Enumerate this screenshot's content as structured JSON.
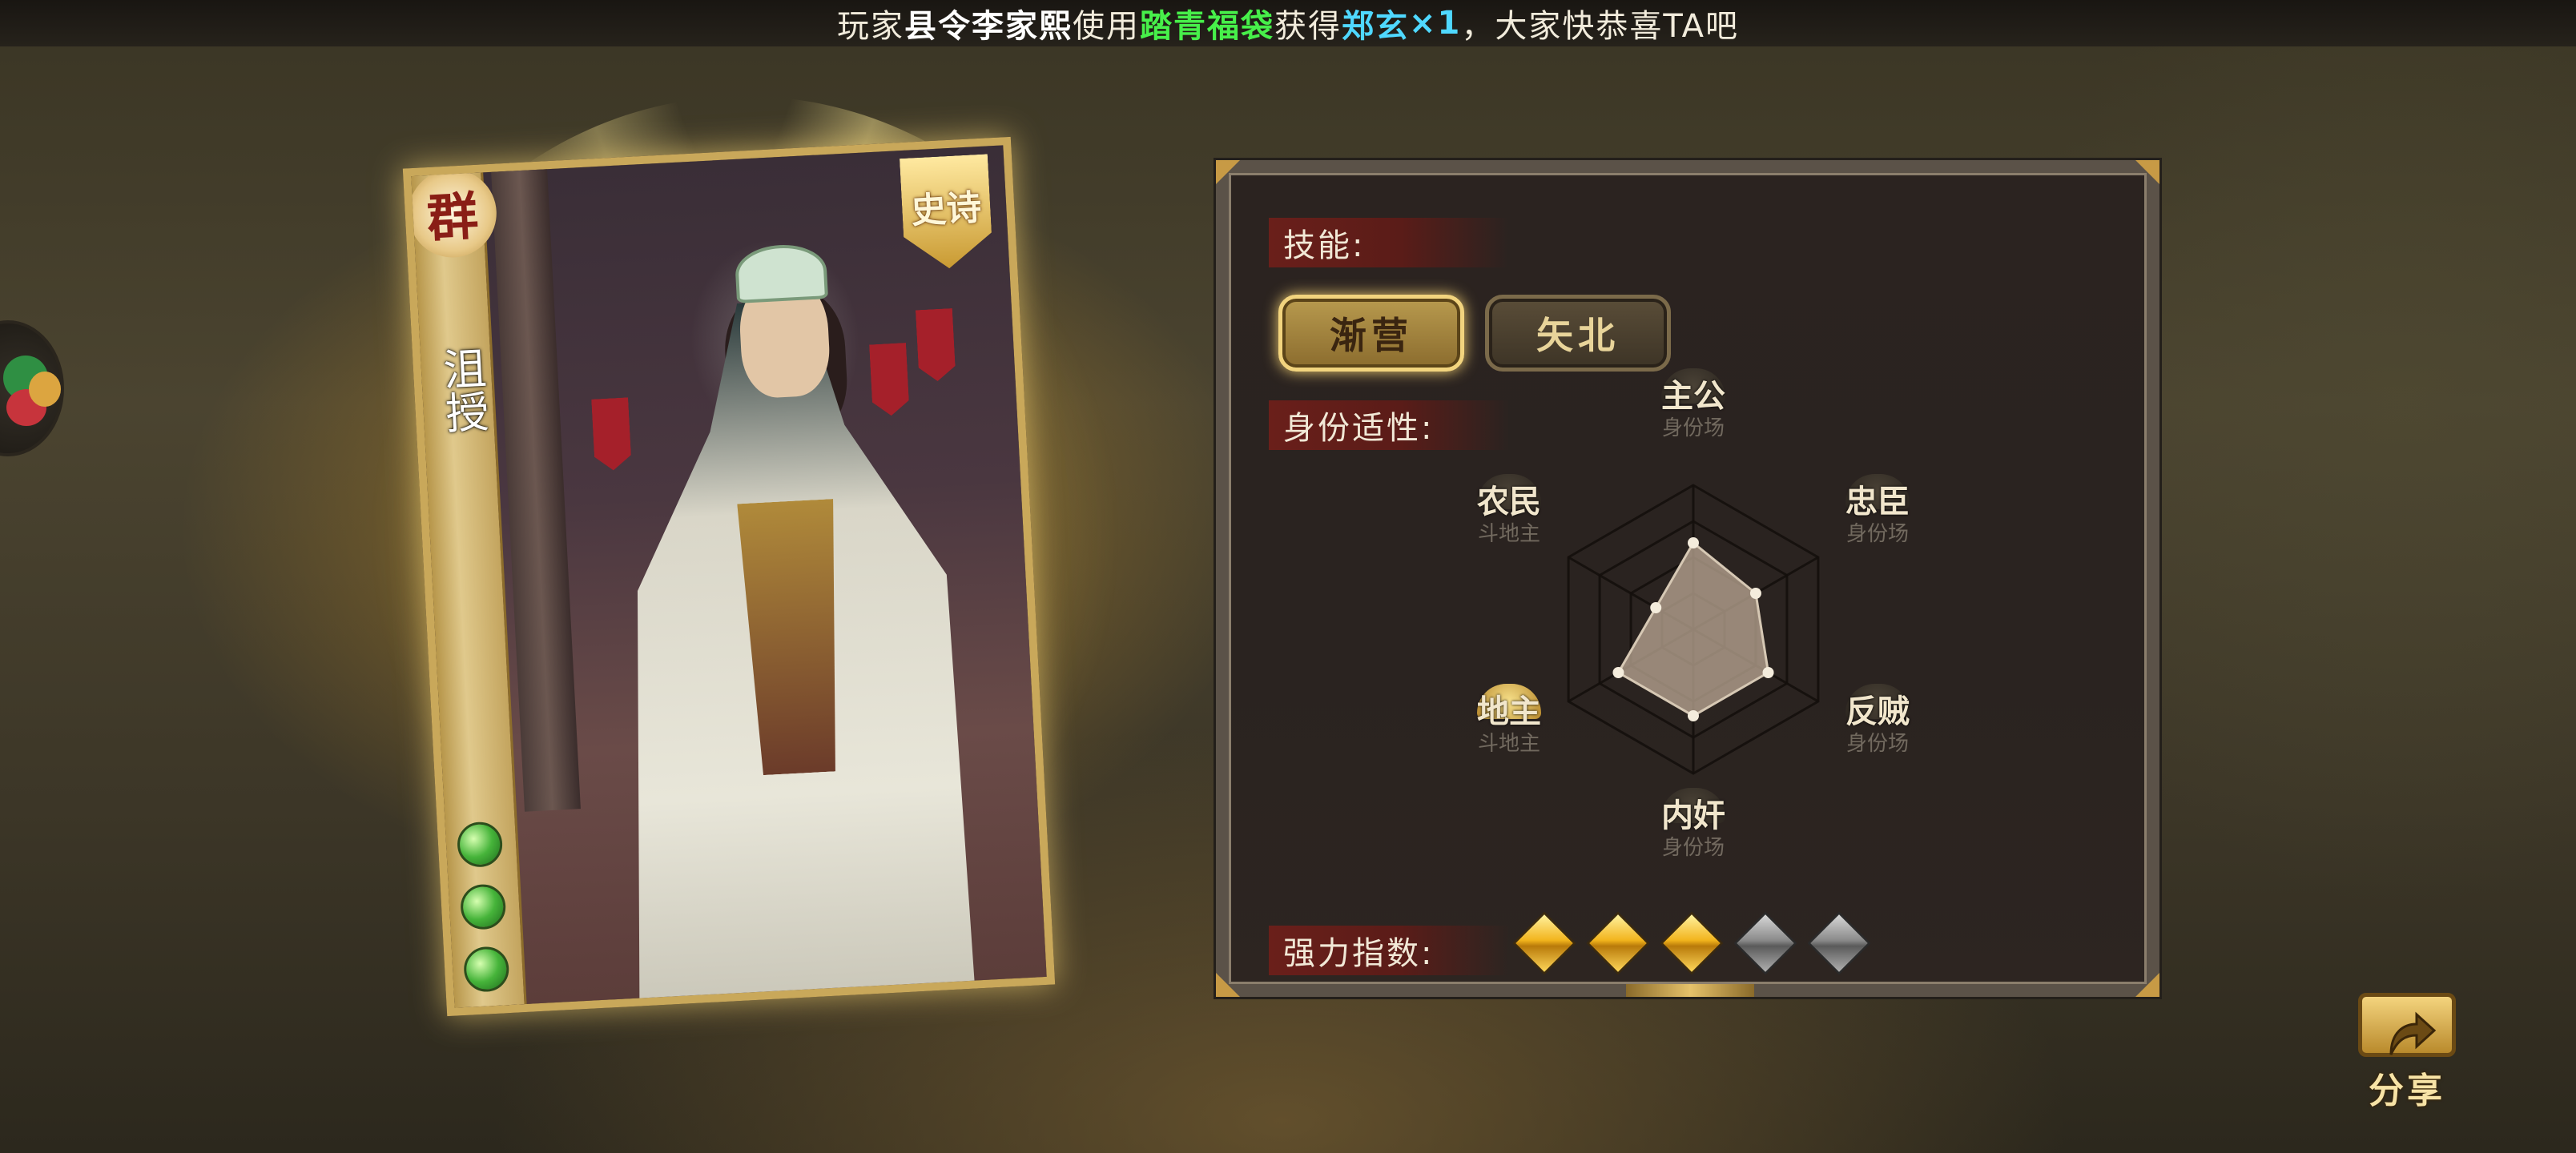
{
  "banner": {
    "prefix": "玩家",
    "player_name": "县令李家熙",
    "verb": "使用",
    "item": "踏青福袋",
    "obtain": "获得",
    "general": "郑玄",
    "count": "×1",
    "suffix": "，大家快恭喜TA吧"
  },
  "card": {
    "faction": "群",
    "hero_name": "沮授",
    "rarity": "史诗",
    "health": 3,
    "icons": [
      "faction-seal-icon",
      "rarity-badge-icon",
      "health-orb-icon"
    ]
  },
  "panel": {
    "skill_label": "技能:",
    "skills": [
      {
        "name": "渐营",
        "selected": true
      },
      {
        "name": "矢北",
        "selected": false
      }
    ],
    "role_label": "身份适性:",
    "roles": [
      {
        "name": "主公",
        "mode": "身份场",
        "highlighted": false
      },
      {
        "name": "忠臣",
        "mode": "身份场",
        "highlighted": false
      },
      {
        "name": "反贼",
        "mode": "身份场",
        "highlighted": false
      },
      {
        "name": "内奸",
        "mode": "身份场",
        "highlighted": false
      },
      {
        "name": "地主",
        "mode": "斗地主",
        "highlighted": true
      },
      {
        "name": "农民",
        "mode": "斗地主",
        "highlighted": false
      }
    ],
    "radar_values": [
      0.6,
      0.5,
      0.6,
      0.6,
      0.6,
      0.3
    ],
    "power_label": "强力指数:",
    "power_rating": 3,
    "power_max": 5
  },
  "share": {
    "label": "分享"
  },
  "colors": {
    "banner_player": "#ffffff",
    "banner_item": "#47f04a",
    "banner_general": "#4fd8ff",
    "label_bg": "#6a1f1a",
    "gold": "#f2b41c"
  }
}
